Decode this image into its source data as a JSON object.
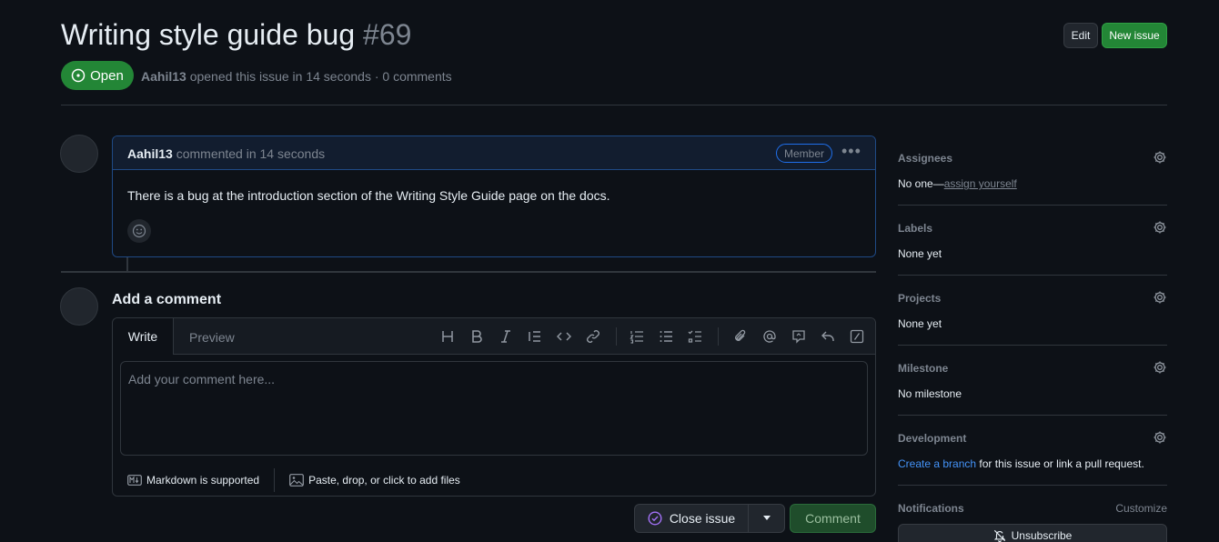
{
  "issue": {
    "title": "Writing style guide bug",
    "number": "#69",
    "state": "Open",
    "author": "Aahil13",
    "meta_text": "opened this issue in 14 seconds · 0 comments"
  },
  "header_buttons": {
    "edit": "Edit",
    "new_issue": "New issue"
  },
  "comment": {
    "author": "Aahil13",
    "time_text": "commented in 14 seconds",
    "badge": "Member",
    "body": "There is a bug at the introduction section of the Writing Style Guide page on the docs."
  },
  "composer": {
    "title": "Add a comment",
    "tabs": [
      "Write",
      "Preview"
    ],
    "placeholder": "Add your comment here...",
    "markdown_note": "Markdown is supported",
    "attach_note": "Paste, drop, or click to add files",
    "toolbar_icons": [
      "heading-icon",
      "bold-icon",
      "italic-icon",
      "quote-icon",
      "code-icon",
      "link-icon",
      "ordered-list-icon",
      "unordered-list-icon",
      "task-list-icon",
      "attach-icon",
      "mention-icon",
      "reference-icon",
      "reply-icon",
      "slash-command-icon"
    ]
  },
  "actions": {
    "close_issue": "Close issue",
    "comment": "Comment"
  },
  "sidebar": {
    "assignees": {
      "label": "Assignees",
      "value_prefix": "No one—",
      "value_link": "assign yourself"
    },
    "labels": {
      "label": "Labels",
      "value": "None yet"
    },
    "projects": {
      "label": "Projects",
      "value": "None yet"
    },
    "milestone": {
      "label": "Milestone",
      "value": "No milestone"
    },
    "development": {
      "label": "Development",
      "link": "Create a branch",
      "value_suffix": " for this issue or link a pull request."
    },
    "notifications": {
      "label": "Notifications",
      "customize": "Customize",
      "unsubscribe": "Unsubscribe"
    }
  },
  "colors": {
    "background": "#0d1117",
    "open_green": "#238636",
    "accent_blue": "#4493f8",
    "border": "#30363d"
  }
}
